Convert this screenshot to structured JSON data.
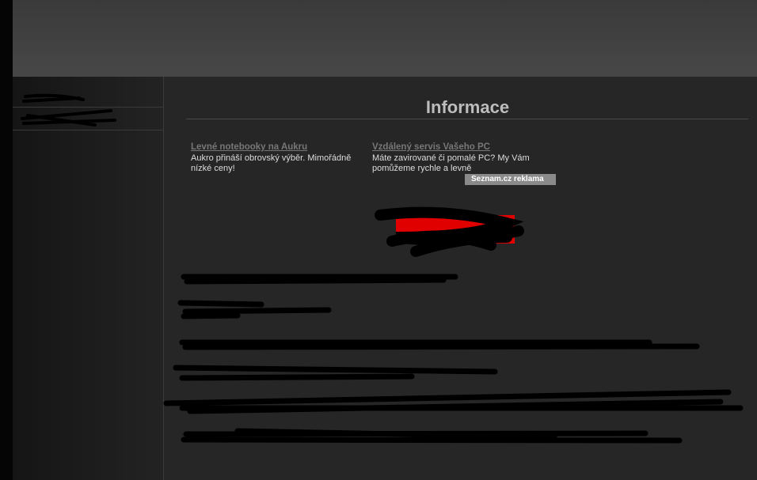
{
  "page": {
    "title": "Informace"
  },
  "ads": [
    {
      "title": "Levné notebooky na Aukru",
      "text": "Aukro přináší obrovský výběr. Mimořádně nízké ceny!"
    },
    {
      "title": "Vzdálený servis Vašeho PC",
      "text": "Máte zavirované či pomalé PC? My Vám pomůžeme rychle a levně"
    }
  ],
  "ad_badge": {
    "brand": "Seznam.cz",
    "label": "reklama"
  }
}
